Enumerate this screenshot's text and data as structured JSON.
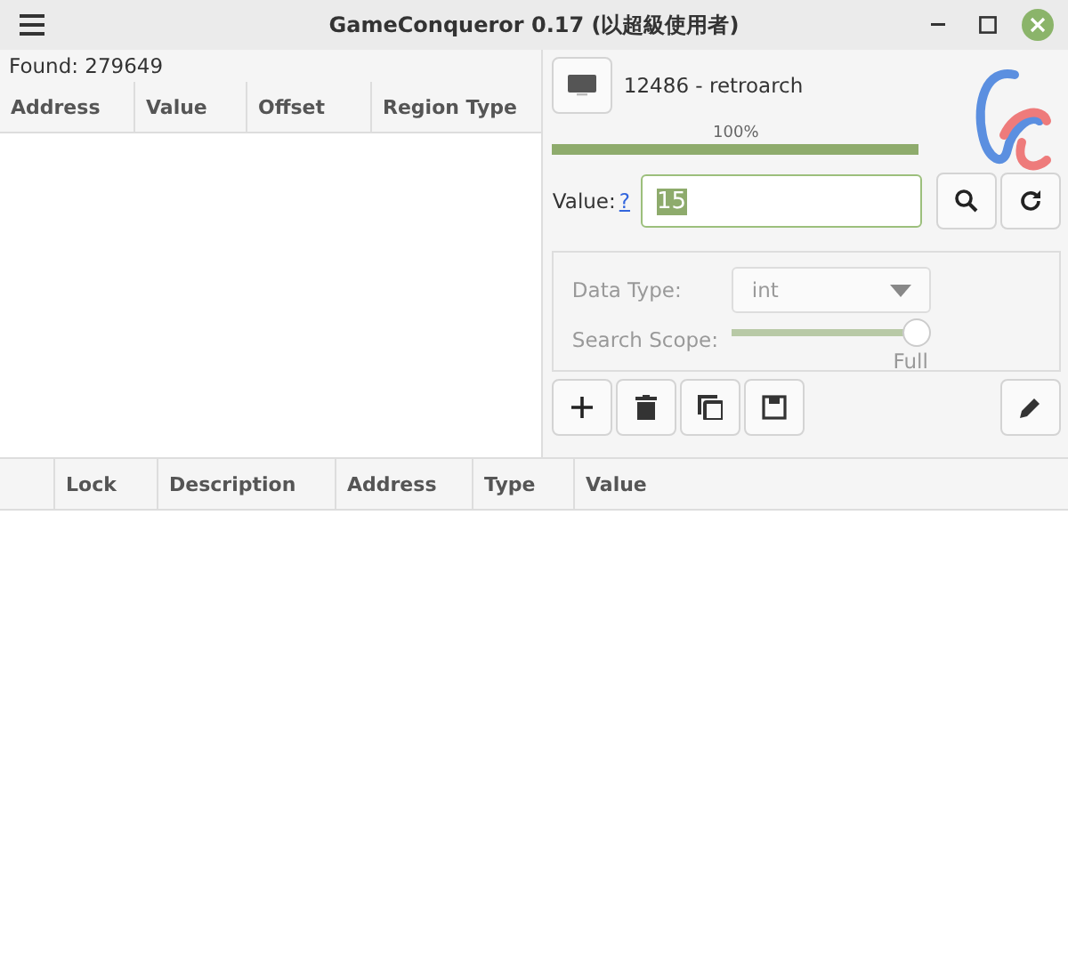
{
  "window": {
    "title": "GameConqueror 0.17 (以超級使用者)"
  },
  "found": "Found: 279649",
  "scan_table": {
    "columns": [
      "Address",
      "Value",
      "Offset",
      "Region Type"
    ]
  },
  "process": {
    "label": "12486 - retroarch"
  },
  "progress": {
    "level": 1.0,
    "reading": "100%"
  },
  "value": {
    "label": "Value:",
    "help_link": "?",
    "text": "15",
    "text_selected": true
  },
  "options": {
    "disabled": true,
    "data_type_label": "Data Type:",
    "data_type": "int",
    "scope_label": "Search Scope:",
    "scope": {
      "level": 1.0,
      "reading": "Full"
    }
  },
  "cheat_table": {
    "columns": [
      "",
      "Lock",
      "Description",
      "Address",
      "Type",
      "Value"
    ]
  }
}
